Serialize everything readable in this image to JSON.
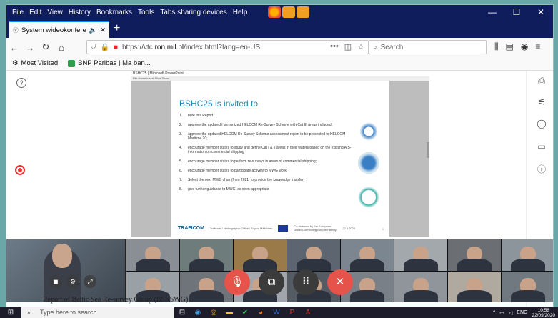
{
  "menu": {
    "items": [
      "File",
      "Edit",
      "View",
      "History",
      "Bookmarks",
      "Tools",
      "Tabs sharing devices",
      "Help"
    ]
  },
  "window_controls": {
    "minimize": "—",
    "maximize": "☐",
    "close": "✕"
  },
  "tab": {
    "title": "System wideokonferencyjny",
    "close": "✕",
    "new": "+"
  },
  "nav": {
    "url_prefix": "https://vtc.",
    "url_host": "ron.mil.pl",
    "url_rest": "/index.html?lang=en-US",
    "search_placeholder": "Search",
    "page_actions": "•••"
  },
  "bookmarks": {
    "most_visited": "Most Visited",
    "bnp": "BNP Paribas | Ma ban..."
  },
  "slide": {
    "window_title": "BSHC25 | Microsoft PowerPoint",
    "menu_text": "File  Home  Insert  Slide  Show",
    "title": "BSHC25 is invited to",
    "items": [
      {
        "n": "1.",
        "t": "note this Report"
      },
      {
        "n": "2.",
        "t": "approve the updated Harmonized HELCOM Re-Survey Scheme with Cat III areas included;"
      },
      {
        "n": "3.",
        "t": "approve the updated HELCOM Re-Survey Scheme assessment report to be presented to HELCOM Maritime 20;"
      },
      {
        "n": "4.",
        "t": "encourage member states to study and define Cat I & II areas in their waters based on the existing AIS-information on commercial shipping"
      },
      {
        "n": "5.",
        "t": "encourage member states to perform re-surveys in areas of commercial shipping;"
      },
      {
        "n": "6.",
        "t": "encourage member states to participate actively to MWG work"
      },
      {
        "n": "7.",
        "t": "Select the next MWG chair (from 2021, to provide the knowledge transfer)"
      },
      {
        "n": "8.",
        "t": "give further guidance to MWG, as seen appropriate"
      }
    ],
    "footer_logo": "TRAFICOM",
    "footer_org": "Traficom / Hydrographic Office / Suppo Mälkönen",
    "footer_eu": "Co-financed by the European Union Connecting Europe Facility",
    "footer_date": "22.9.2020",
    "page_num": "9"
  },
  "colors": {
    "menubar": "#0f1d5c",
    "accent": "#0a84ff",
    "slide_title": "#2a8ab5",
    "hangup": "#e5534b",
    "desktop": "#6aa7a8"
  },
  "behind_text": "Report of Baltic Sea Re-survey Group (BSRSWG)",
  "taskbar": {
    "search_placeholder": "Type here to search",
    "language": "ENG",
    "time": "10:58",
    "date": "22/09/2020"
  }
}
